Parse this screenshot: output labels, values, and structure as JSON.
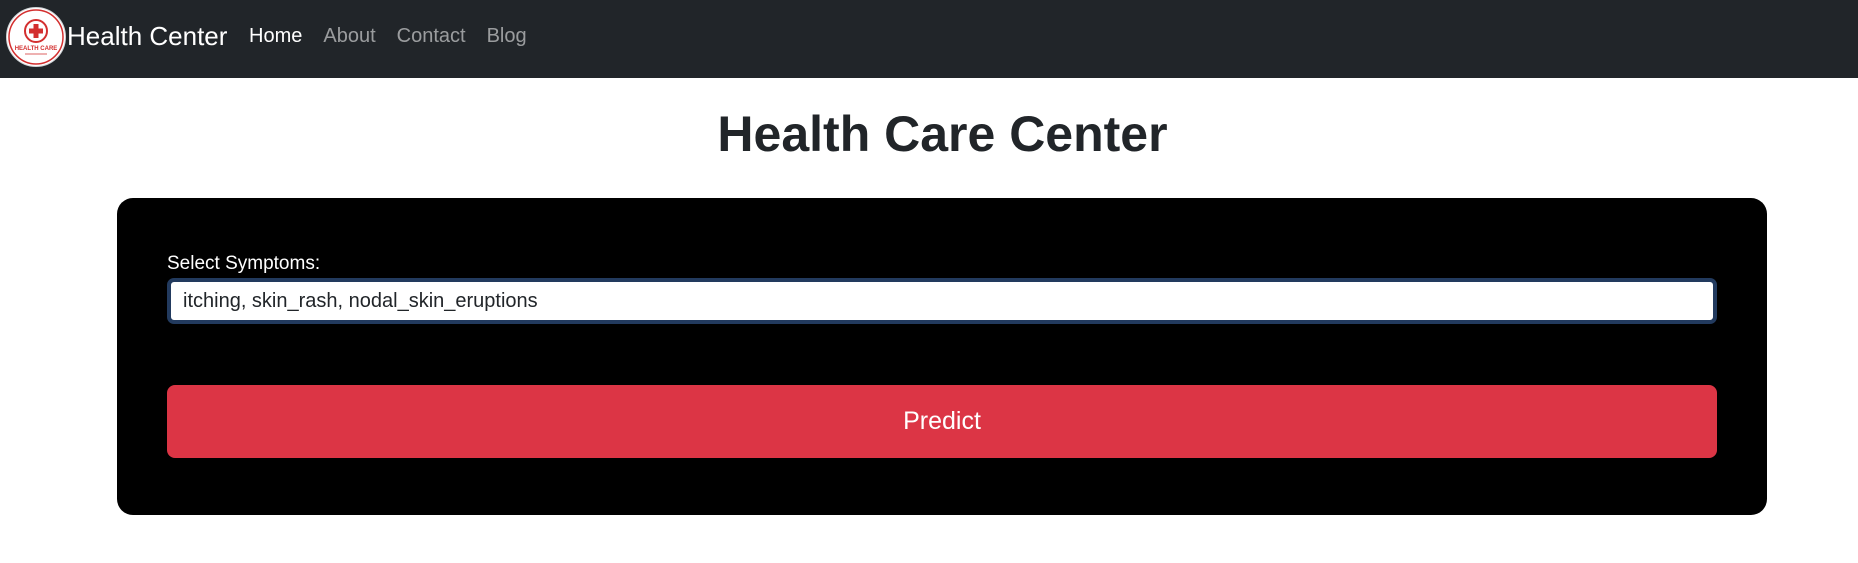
{
  "navbar": {
    "logo_text": "HEALTH CARE",
    "brand": "Health Center",
    "links": [
      {
        "label": "Home",
        "active": true
      },
      {
        "label": "About",
        "active": false
      },
      {
        "label": "Contact",
        "active": false
      },
      {
        "label": "Blog",
        "active": false
      }
    ]
  },
  "main": {
    "title": "Health Care Center",
    "form": {
      "symptoms_label": "Select Symptoms:",
      "symptoms_value": "itching, skin_rash, nodal_skin_eruptions",
      "predict_label": "Predict"
    }
  },
  "colors": {
    "navbar_bg": "#212529",
    "panel_bg": "#000000",
    "button_bg": "#dc3545",
    "logo_accent": "#d32f2f"
  }
}
